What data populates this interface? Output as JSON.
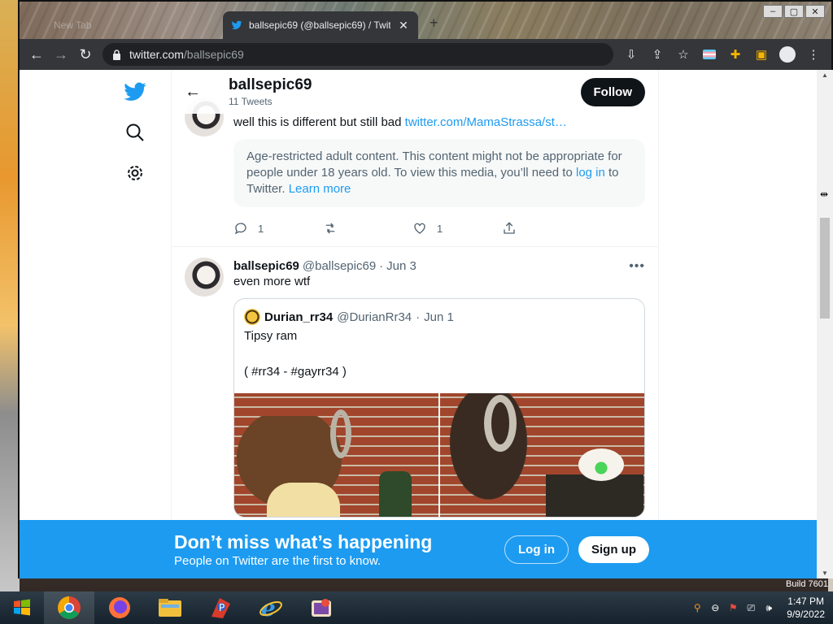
{
  "browser": {
    "inactive_tab": "New Tab",
    "active_tab": "ballsepic69 (@ballsepic69) / Twit",
    "new_tab_symbol": "+",
    "url_host": "twitter.com",
    "url_path": "/ballsepic69",
    "window_controls": [
      "–",
      "▢",
      "✕"
    ]
  },
  "sidenav": {
    "items": [
      "twitter-logo",
      "search",
      "settings"
    ]
  },
  "profile": {
    "name": "ballsepic69",
    "tweet_count": "11 Tweets",
    "follow_label": "Follow"
  },
  "tweet1": {
    "text": "well this is different but still bad ",
    "link": "twitter.com/MamaStrassa/st…",
    "age_notice": "Age-restricted adult content. This content might not be appropriate for people under 18 years old. To view this media, you’ll need to ",
    "age_login": "log in",
    "age_mid": " to Twitter. ",
    "age_learn": "Learn more",
    "replies": "1",
    "likes": "1"
  },
  "tweet2": {
    "name": "ballsepic69",
    "handle": "@ballsepic69",
    "sep": "·",
    "date": "Jun 3",
    "text": "even more wtf",
    "more": "•••",
    "quote": {
      "name": "Durian_rr34",
      "handle": "@DurianRr34",
      "sep": "·",
      "date": "Jun 1",
      "line1": "Tipsy ram",
      "line2": "( #rr34 - #gayrr34 )"
    }
  },
  "banner": {
    "title": "Don’t miss what’s happening",
    "subtitle": "People on Twitter are the first to know.",
    "login": "Log in",
    "signup": "Sign up"
  },
  "os": {
    "build": "Build 7601",
    "time": "1:47 PM",
    "date": "9/9/2022",
    "taskbar_apps": [
      "chrome",
      "firefox",
      "file-explorer",
      "paint-app",
      "internet-explorer",
      "game-app"
    ]
  },
  "colors": {
    "twitter_blue": "#1d9bf0",
    "text_dark": "#0f1419",
    "text_muted": "#536471"
  }
}
